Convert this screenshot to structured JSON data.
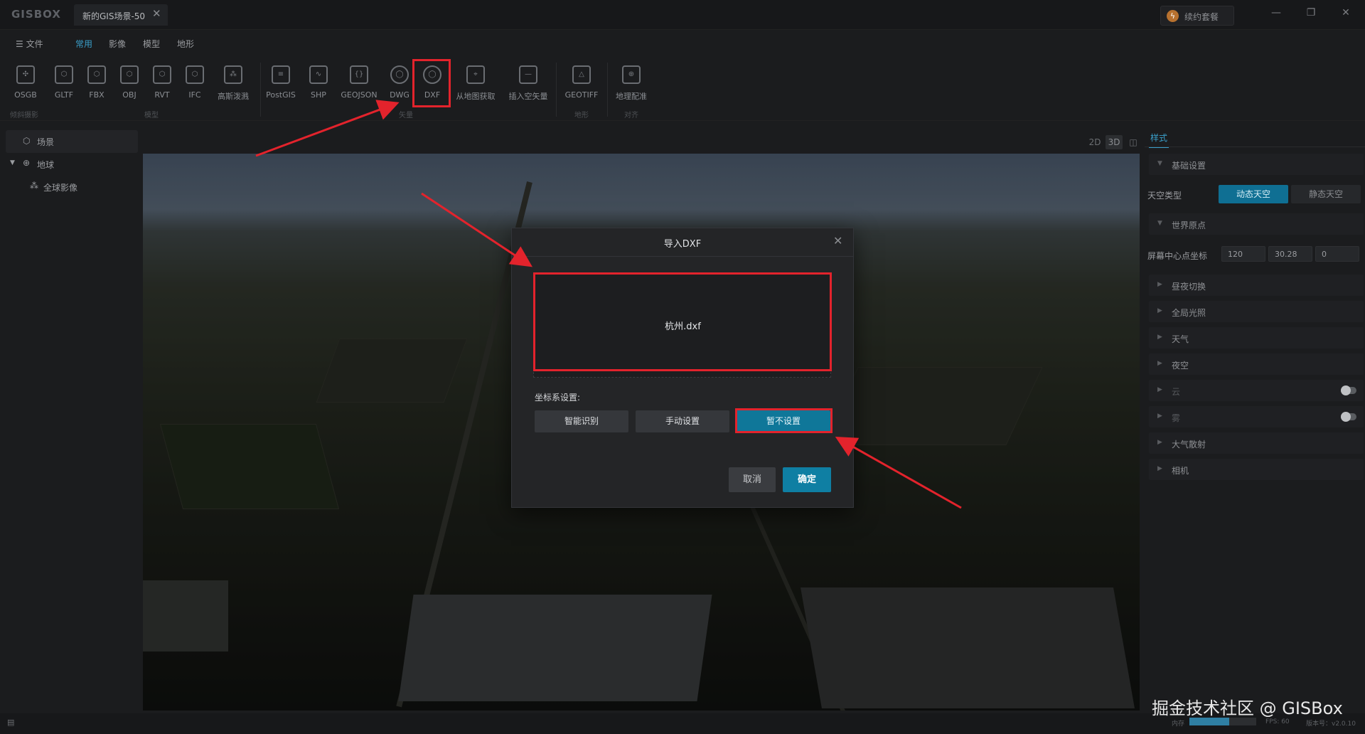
{
  "app": {
    "logo": "GISBOX",
    "tab_title": "新的GIS场景-50",
    "renew_label": "续约套餐",
    "renew_icon": "lightning-icon"
  },
  "window": {
    "minimize": "—",
    "restore": "❐",
    "close": "✕"
  },
  "menu": {
    "file": "文件",
    "tabs": [
      "常用",
      "影像",
      "模型",
      "地形"
    ],
    "active_tab": "常用"
  },
  "ribbon": {
    "buttons": [
      {
        "label": "OSGB",
        "icon": "drone-icon"
      },
      {
        "label": "GLTF",
        "icon": "cube-icon"
      },
      {
        "label": "FBX",
        "icon": "cube-icon"
      },
      {
        "label": "OBJ",
        "icon": "cube-icon"
      },
      {
        "label": "RVT",
        "icon": "cube-icon"
      },
      {
        "label": "IFC",
        "icon": "cube-icon"
      },
      {
        "label": "高斯泼溅",
        "icon": "splat-icon"
      },
      {
        "label": "PostGIS",
        "icon": "database-icon"
      },
      {
        "label": "SHP",
        "icon": "shp-icon"
      },
      {
        "label": "GEOJSON",
        "icon": "geojson-icon"
      },
      {
        "label": "DWG",
        "icon": "dwg-icon"
      },
      {
        "label": "DXF",
        "icon": "dxf-icon"
      },
      {
        "label": "从地图获取",
        "icon": "map-pick-icon"
      },
      {
        "label": "插入空矢量",
        "icon": "vector-icon"
      },
      {
        "label": "GEOTIFF",
        "icon": "terrain-icon"
      },
      {
        "label": "地理配准",
        "icon": "georeference-icon"
      }
    ],
    "groups": [
      "倾斜摄影",
      "模型",
      "矢量",
      "地形",
      "对齐"
    ]
  },
  "scene_tree": {
    "scene": "场景",
    "earth": "地球",
    "imagery": "全球影像"
  },
  "view_toggle": [
    "2D",
    "3D",
    "◫"
  ],
  "dialog": {
    "title": "导入DXF",
    "file_name": "杭州.dxf",
    "crs_label": "坐标系设置:",
    "crs_options": [
      "智能识别",
      "手动设置",
      "暂不设置"
    ],
    "crs_selected": "暂不设置",
    "cancel": "取消",
    "confirm": "确定"
  },
  "style_panel": {
    "tab": "样式",
    "basic": "基础设置",
    "sky_type_label": "天空类型",
    "sky_dynamic": "动态天空",
    "sky_static": "静态天空",
    "world_origin": "世界原点",
    "screen_center_label": "屏幕中心点坐标",
    "coords": [
      "120",
      "30.28",
      "0"
    ],
    "sections": [
      "昼夜切换",
      "全局光照",
      "天气",
      "夜空",
      "云",
      "雾",
      "大气散射",
      "相机"
    ]
  },
  "status": {
    "memory_label": "内存",
    "memory_fraction": 0.6,
    "fps": "FPS: 60",
    "version": "版本号：v2.0.10"
  },
  "watermark": "掘金技术社区 @ GISBox",
  "colors": {
    "accent": "#0f7fa3",
    "highlight": "#e3232c",
    "bg": "#1b1c1e"
  }
}
